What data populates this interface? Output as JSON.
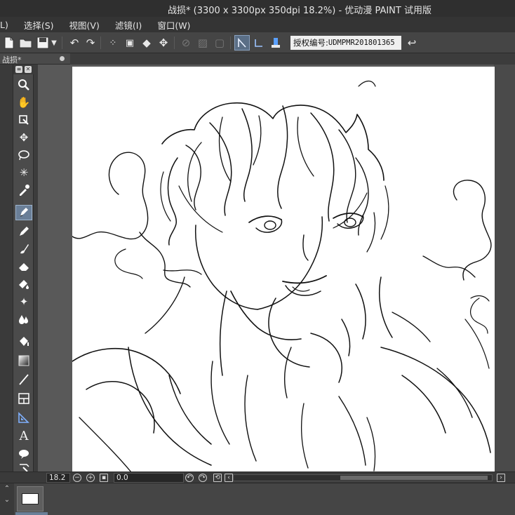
{
  "window": {
    "title": "战损* (3300 x 3300px 350dpi 18.2%) - 优动漫 PAINT 试用版"
  },
  "menu": {
    "items": [
      "L)",
      "选择(S)",
      "视图(V)",
      "滤镜(I)",
      "窗口(W)"
    ]
  },
  "toolbar": {
    "license_label": "授权编号:",
    "license_code": "UDMPMR201801365"
  },
  "document": {
    "tab_title": "战损*"
  },
  "tools": [
    "zoom-tool",
    "hand-tool",
    "object-tool",
    "move-tool",
    "lasso-tool",
    "magic-wand-tool",
    "eyedropper-tool",
    "pen-tool",
    "pencil-tool",
    "brush-tool",
    "eraser-tool",
    "fill-tool",
    "sparkle-tool",
    "blend-tool",
    "bucket-tool",
    "gradient-tool",
    "line-tool",
    "frame-tool",
    "ruler-tool",
    "text-tool",
    "balloon-tool",
    "correct-line-tool"
  ],
  "status": {
    "zoom_value": "18.2",
    "rotation_value": "0.0"
  },
  "colors": {
    "accent": "#6a7f98",
    "canvas_bg": "#595959",
    "paper": "#ffffff"
  }
}
